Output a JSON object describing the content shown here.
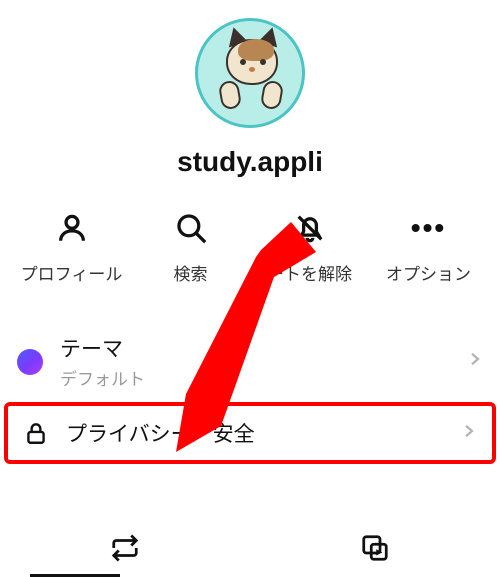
{
  "profile": {
    "username": "study.appli"
  },
  "actions": {
    "profile_label": "プロフィール",
    "search_label": "検索",
    "mute_label": "ートを解除",
    "options_label": "オプション"
  },
  "settings": {
    "theme": {
      "title": "テーマ",
      "subtitle": "デフォルト"
    },
    "privacy": {
      "title": "プライバシー・安全"
    }
  },
  "highlight": {
    "color": "#ff0000",
    "target": "privacy-row"
  }
}
